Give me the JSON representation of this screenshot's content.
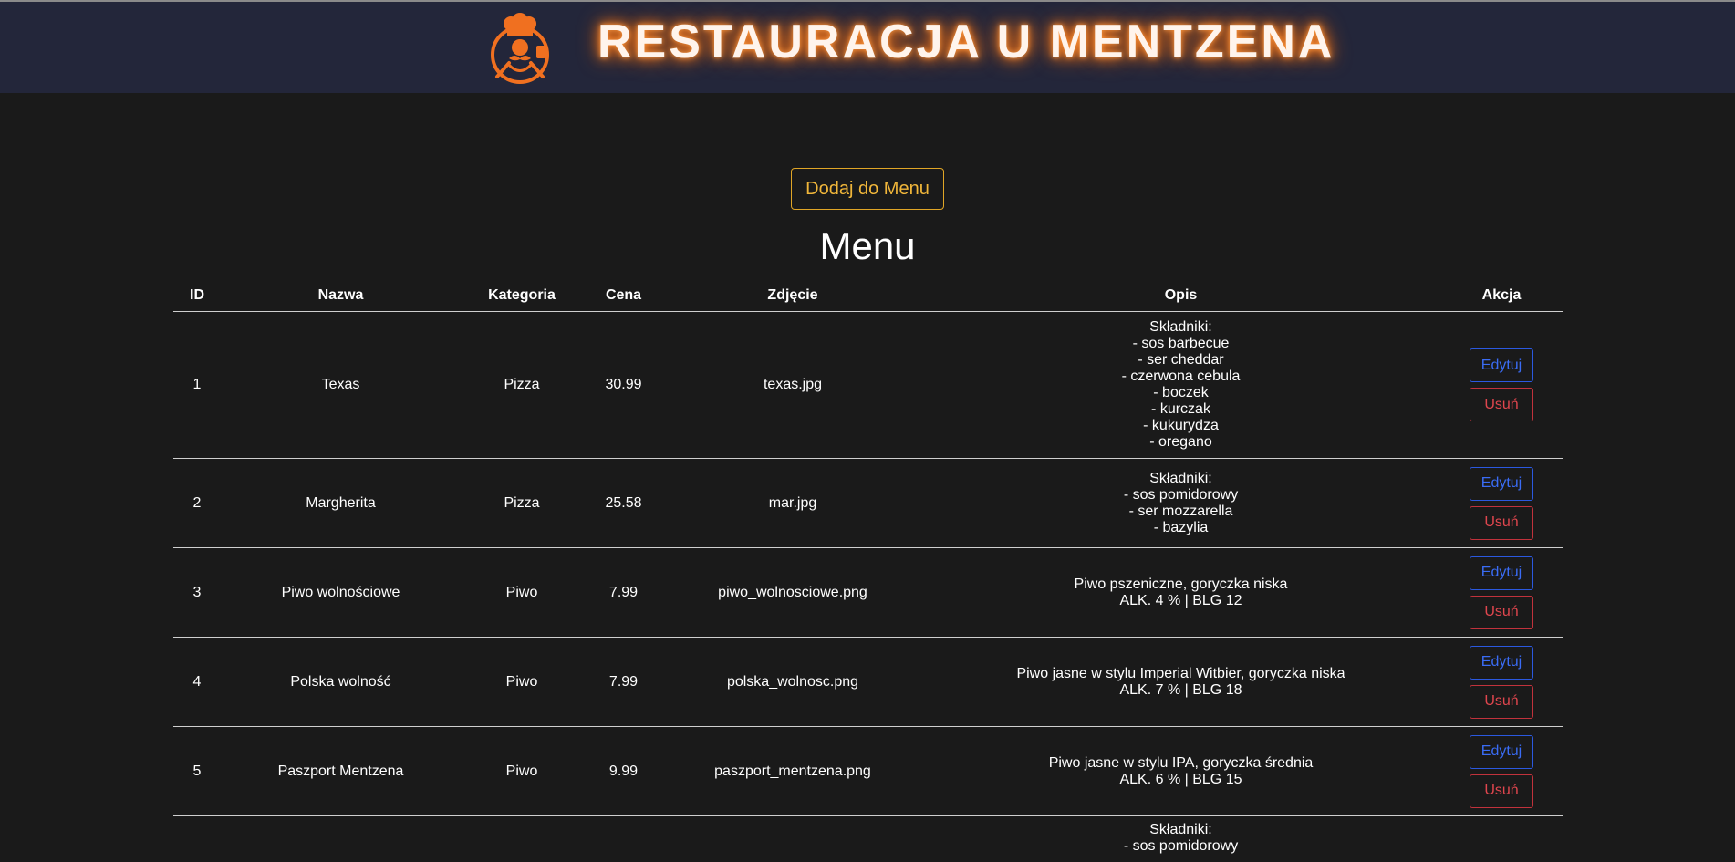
{
  "header": {
    "title": "RESTAURACJA U MENTZENA",
    "logo_icon": "chef-logo-icon",
    "accent_color": "#f07020"
  },
  "toolbar": {
    "add_label": "Dodaj do Menu"
  },
  "page_title": "Menu",
  "table": {
    "columns": [
      "ID",
      "Nazwa",
      "Kategoria",
      "Cena",
      "Zdjęcie",
      "Opis",
      "Akcja"
    ],
    "edit_label": "Edytuj",
    "delete_label": "Usuń",
    "rows": [
      {
        "id": "1",
        "name": "Texas",
        "category": "Pizza",
        "price": "30.99",
        "image": "texas.jpg",
        "description": "Składniki:\n- sos barbecue\n- ser cheddar\n- czerwona cebula\n- boczek\n- kurczak\n- kukurydza\n- oregano"
      },
      {
        "id": "2",
        "name": "Margherita",
        "category": "Pizza",
        "price": "25.58",
        "image": "mar.jpg",
        "description": "Składniki:\n- sos pomidorowy\n- ser mozzarella\n- bazylia"
      },
      {
        "id": "3",
        "name": "Piwo wolnościowe",
        "category": "Piwo",
        "price": "7.99",
        "image": "piwo_wolnosciowe.png",
        "description": "Piwo pszeniczne, goryczka niska\nALK. 4 % | BLG 12"
      },
      {
        "id": "4",
        "name": "Polska wolność",
        "category": "Piwo",
        "price": "7.99",
        "image": "polska_wolnosc.png",
        "description": "Piwo jasne w stylu Imperial Witbier, goryczka niska\nALK. 7 % | BLG 18"
      },
      {
        "id": "5",
        "name": "Paszport Mentzena",
        "category": "Piwo",
        "price": "9.99",
        "image": "paszport_mentzena.png",
        "description": "Piwo jasne w stylu IPA, goryczka średnia\nALK. 6 % | BLG 15"
      }
    ],
    "partial_row": {
      "description": "Składniki:\n- sos pomidorowy"
    }
  }
}
